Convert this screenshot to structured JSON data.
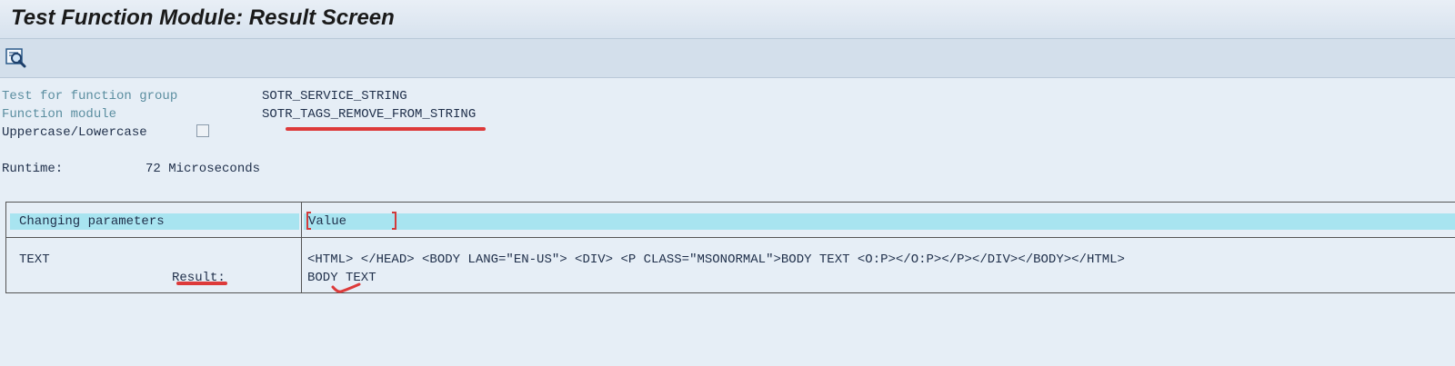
{
  "window": {
    "title": "Test Function Module: Result Screen"
  },
  "toolbar": {
    "items": [
      {
        "icon": "search-icon",
        "tooltip": ""
      }
    ]
  },
  "header": {
    "function_group_label": "Test for function group",
    "function_group_value": "SOTR_SERVICE_STRING",
    "function_module_label": "Function module",
    "function_module_value": "SOTR_TAGS_REMOVE_FROM_STRING",
    "case_label": "Uppercase/Lowercase",
    "case_checked": false,
    "runtime_label": "Runtime:",
    "runtime_value": "72 Microseconds"
  },
  "table": {
    "col_param_header": "Changing parameters",
    "col_value_header": "Value",
    "rows": [
      {
        "name": "TEXT",
        "result_label": "Result:",
        "input": "<HTML> </HEAD> <BODY LANG=\"EN-US\"> <DIV> <P CLASS=\"MSONORMAL\">BODY TEXT <O:P></O:P></P></DIV></BODY></HTML>",
        "output": "BODY TEXT"
      }
    ]
  },
  "colors": {
    "highlight": "#a8e4f0",
    "annotation": "#dd3a3a",
    "label": "#5b8ea0"
  }
}
